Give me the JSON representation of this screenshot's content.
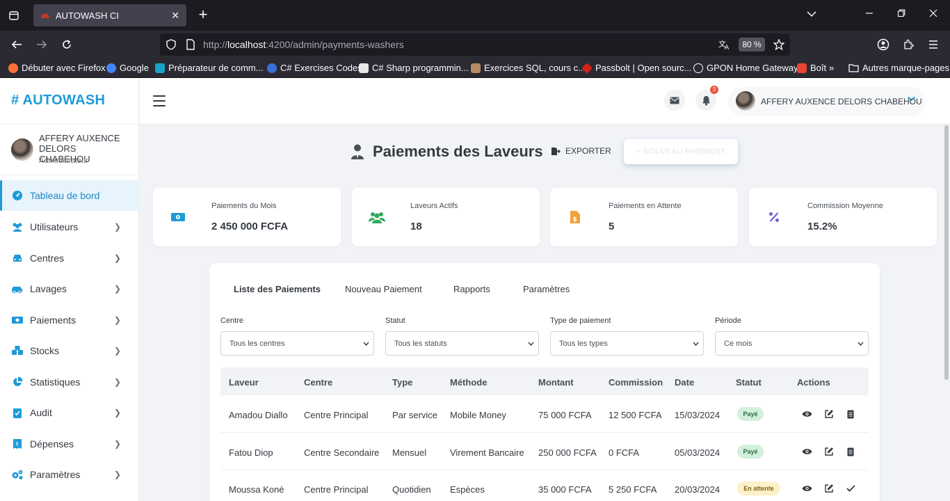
{
  "browser": {
    "tab_title": "AUTOWASH CI",
    "url_prefix": "http://",
    "url_host": "localhost",
    "url_rest": ":4200/admin/payments-washers",
    "zoom": "80 %",
    "bookmarks": [
      {
        "label": "Débuter avec Firefox",
        "color": "#ff7139"
      },
      {
        "label": "Google",
        "color": "#4285f4"
      },
      {
        "label": "Préparateur de comm...",
        "color": "#1aa3c9"
      },
      {
        "label": "C# Exercises Codes",
        "color": "#3a6fd8"
      },
      {
        "label": "C# Sharp programmin...",
        "color": "#e8e8e8"
      },
      {
        "label": "Exercices SQL, cours c...",
        "color": "#b58b63"
      },
      {
        "label": "Passbolt | Open sourc...",
        "color": "#d1231b"
      },
      {
        "label": "GPON Home Gateway",
        "color": "#fbfbfe"
      },
      {
        "label": "Boît",
        "color": "#ea4335"
      }
    ],
    "other_bookmarks": "Autres marque-pages"
  },
  "sidebar": {
    "brand": "# AUTOWASH",
    "user_name": "AFFERY AUXENCE DELORS CHABEHOU",
    "user_role": "Administrateur",
    "items": [
      {
        "label": "Tableau de bord",
        "icon": "dashboard-icon",
        "active": true
      },
      {
        "label": "Utilisateurs",
        "icon": "users-icon"
      },
      {
        "label": "Centres",
        "icon": "car-icon"
      },
      {
        "label": "Lavages",
        "icon": "car-wash-icon"
      },
      {
        "label": "Paiements",
        "icon": "money-icon"
      },
      {
        "label": "Stocks",
        "icon": "boxes-icon"
      },
      {
        "label": "Statistiques",
        "icon": "pie-chart-icon"
      },
      {
        "label": "Audit",
        "icon": "clipboard-check-icon"
      },
      {
        "label": "Dépenses",
        "icon": "receipt-icon"
      },
      {
        "label": "Paramètres",
        "icon": "cogs-icon"
      }
    ]
  },
  "topbar": {
    "notifications_count": "3",
    "user_name": "AFFERY AUXENCE DELORS CHABEHOU"
  },
  "page": {
    "title": "Paiements des Laveurs",
    "export_label": "EXPORTER",
    "new_payment_label": "+ NOUVEAU PAIEMENT"
  },
  "stats": [
    {
      "label": "Paiements du Mois",
      "value": "2 450 000 FCFA",
      "icon": "money-bill-icon",
      "color": "#1e9bd7"
    },
    {
      "label": "Laveurs Actifs",
      "value": "18",
      "icon": "users-icon",
      "color": "#2eaa5e"
    },
    {
      "label": "Paiements en Attente",
      "value": "5",
      "icon": "invoice-dollar-icon",
      "color": "#f0a23c"
    },
    {
      "label": "Commission Moyenne",
      "value": "15.2%",
      "icon": "percent-icon",
      "color": "#7b5cd6"
    }
  ],
  "tabs": [
    "Liste des Paiements",
    "Nouveau Paiement",
    "Rapports",
    "Paramètres"
  ],
  "filters": [
    {
      "label": "Centre",
      "value": "Tous les centres"
    },
    {
      "label": "Statut",
      "value": "Tous les statuts"
    },
    {
      "label": "Type de paiement",
      "value": "Tous les types"
    },
    {
      "label": "Période",
      "value": "Ce mois"
    }
  ],
  "table": {
    "columns": [
      "Laveur",
      "Centre",
      "Type",
      "Méthode",
      "Montant",
      "Commission",
      "Date",
      "Statut",
      "Actions"
    ],
    "rows": [
      {
        "laveur": "Amadou Diallo",
        "centre": "Centre Principal",
        "type": "Par service",
        "methode": "Mobile Money",
        "montant": "75 000 FCFA",
        "commission": "12 500 FCFA",
        "date": "15/03/2024",
        "statut": "Payé",
        "statut_kind": "paid"
      },
      {
        "laveur": "Fatou Diop",
        "centre": "Centre Secondaire",
        "type": "Mensuel",
        "methode": "Virement Bancaire",
        "montant": "250 000 FCFA",
        "commission": "0 FCFA",
        "date": "05/03/2024",
        "statut": "Payé",
        "statut_kind": "paid"
      },
      {
        "laveur": "Moussa Koné",
        "centre": "Centre Principal",
        "type": "Quotidien",
        "methode": "Espèces",
        "montant": "35 000 FCFA",
        "commission": "5 250 FCFA",
        "date": "20/03/2024",
        "statut": "En attente",
        "statut_kind": "pending"
      }
    ]
  }
}
